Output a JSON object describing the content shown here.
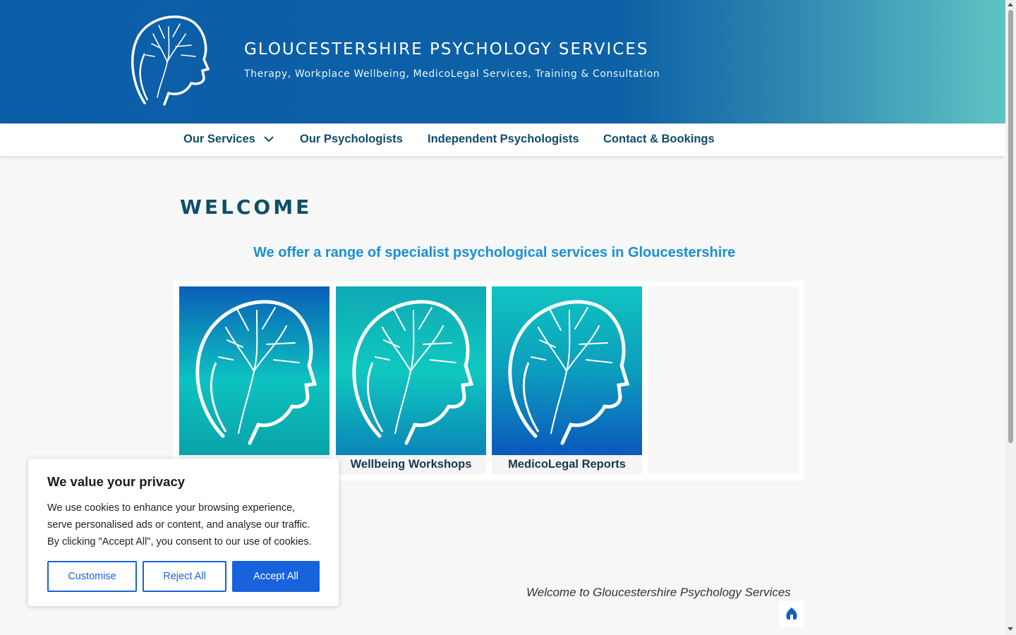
{
  "header": {
    "site_title": "GLOUCESTERSHIRE PSYCHOLOGY SERVICES",
    "tagline": "Therapy, Workplace Wellbeing, MedicoLegal Services, Training & Consultation",
    "logo_icon": "head-tree-brain-logo"
  },
  "nav": {
    "items": [
      {
        "label": "Our Services",
        "has_dropdown": true
      },
      {
        "label": "Our Psychologists"
      },
      {
        "label": "Independent Psychologists"
      },
      {
        "label": "Contact & Bookings"
      }
    ],
    "dropdown_icon": "chevron-down-icon"
  },
  "main": {
    "heading": "WELCOME",
    "subheading": "We offer a range of specialist psychological services in Gloucestershire",
    "services": [
      {
        "caption": "",
        "image": "head-tree-brain-illustration"
      },
      {
        "caption": "Wellbeing Workshops",
        "image": "head-tree-brain-illustration"
      },
      {
        "caption": "MedicoLegal Reports",
        "image": "head-tree-brain-illustration"
      }
    ],
    "intro": "Welcome to Gloucestershire Psychology Services"
  },
  "cookie_banner": {
    "title": "We value your privacy",
    "text": "We use cookies to enhance your browsing experience, serve personalised ads or content, and analyse our traffic. By clicking \"Accept All\", you consent to our use of cookies.",
    "customise_label": "Customise",
    "reject_label": "Reject All",
    "accept_label": "Accept All"
  },
  "colors": {
    "header_blue": "#0b5ea8",
    "header_teal": "#5fc4c4",
    "nav_text": "#0e4c6b",
    "accent_blue": "#1a8fd6",
    "cookie_button": "#1863dc"
  }
}
